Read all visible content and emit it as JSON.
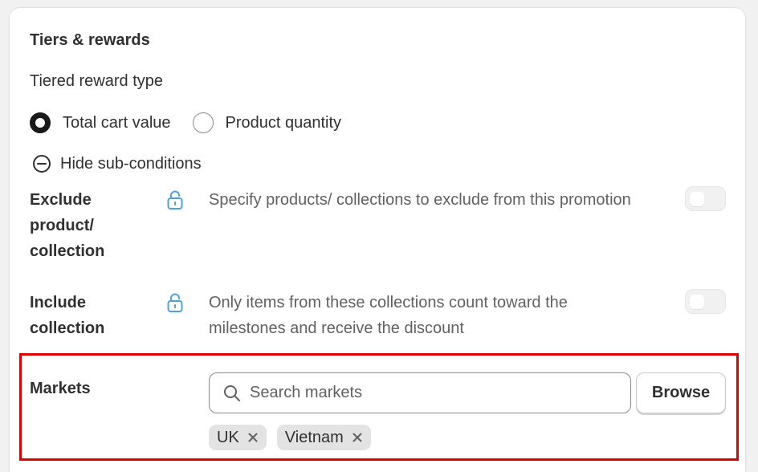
{
  "section": {
    "title": "Tiers & rewards",
    "reward_type_label": "Tiered reward type"
  },
  "reward_type": {
    "options": [
      {
        "label": "Total cart value",
        "selected": true
      },
      {
        "label": "Product quantity",
        "selected": false
      }
    ]
  },
  "sub_conditions": {
    "toggle_label": "Hide sub-conditions",
    "items": [
      {
        "label": "Exclude product/ collection",
        "description": "Specify products/ collections to exclude from this promotion",
        "enabled": false,
        "locked": true
      },
      {
        "label": "Include collection",
        "description": "Only items from these collections count toward the milestones and receive the discount",
        "enabled": false,
        "locked": true
      }
    ]
  },
  "markets": {
    "label": "Markets",
    "search_placeholder": "Search markets",
    "search_value": "",
    "browse_label": "Browse",
    "tags": [
      "UK",
      "Vietnam"
    ]
  },
  "colors": {
    "lock_icon": "#4aa3df",
    "highlight_border": "#e00000"
  },
  "icons": {
    "search": "search-icon",
    "lock": "lock-icon",
    "minus_circle": "minus-circle-icon",
    "remove": "close-icon"
  }
}
